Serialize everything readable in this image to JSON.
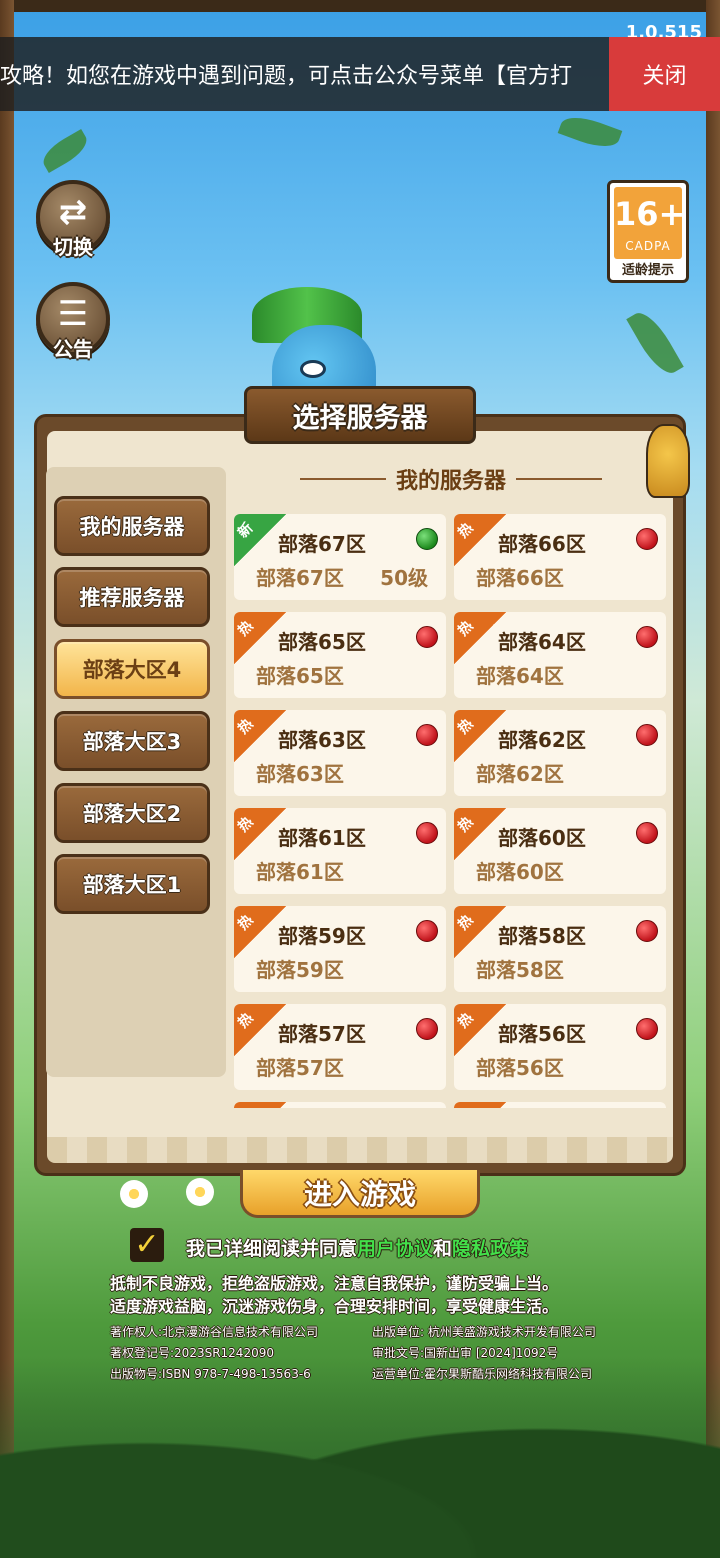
{
  "version": "1.0.515",
  "notice": {
    "text": "攻略！如您在游戏中遇到问题，可点击公众号菜单【官方打",
    "close_label": "关闭"
  },
  "side_buttons": {
    "switch": {
      "glyph": "⇄",
      "label": "切换"
    },
    "announce": {
      "glyph": "☰",
      "label": "公告"
    }
  },
  "age_rating": {
    "age": "16+",
    "org": "CADPA",
    "tip": "适龄提示"
  },
  "panel": {
    "title": "选择服务器",
    "section_title": "我的服务器"
  },
  "categories": [
    {
      "label": "我的服务器",
      "active": false
    },
    {
      "label": "推荐服务器",
      "active": false
    },
    {
      "label": "部落大区4",
      "active": true
    },
    {
      "label": "部落大区3",
      "active": false
    },
    {
      "label": "部落大区2",
      "active": false
    },
    {
      "label": "部落大区1",
      "active": false
    }
  ],
  "servers": [
    {
      "tag": "新",
      "name": "部落67区",
      "sub": "部落67区",
      "level": "50级",
      "status": "green"
    },
    {
      "tag": "热",
      "name": "部落66区",
      "sub": "部落66区",
      "level": "",
      "status": "red"
    },
    {
      "tag": "热",
      "name": "部落65区",
      "sub": "部落65区",
      "level": "",
      "status": "red"
    },
    {
      "tag": "热",
      "name": "部落64区",
      "sub": "部落64区",
      "level": "",
      "status": "red"
    },
    {
      "tag": "热",
      "name": "部落63区",
      "sub": "部落63区",
      "level": "",
      "status": "red"
    },
    {
      "tag": "热",
      "name": "部落62区",
      "sub": "部落62区",
      "level": "",
      "status": "red"
    },
    {
      "tag": "热",
      "name": "部落61区",
      "sub": "部落61区",
      "level": "",
      "status": "red"
    },
    {
      "tag": "热",
      "name": "部落60区",
      "sub": "部落60区",
      "level": "",
      "status": "red"
    },
    {
      "tag": "热",
      "name": "部落59区",
      "sub": "部落59区",
      "level": "",
      "status": "red"
    },
    {
      "tag": "热",
      "name": "部落58区",
      "sub": "部落58区",
      "level": "",
      "status": "red"
    },
    {
      "tag": "热",
      "name": "部落57区",
      "sub": "部落57区",
      "level": "",
      "status": "red"
    },
    {
      "tag": "热",
      "name": "部落56区",
      "sub": "部落56区",
      "level": "",
      "status": "red"
    }
  ],
  "enter_label": "进入游戏",
  "agreement": {
    "prefix": "我已详细阅读并同意",
    "user_agreement": "用户协议",
    "and": "和",
    "privacy": "隐私政策"
  },
  "health_notice": [
    "抵制不良游戏，拒绝盗版游戏，注意自我保护，谨防受骗上当。",
    "适度游戏益脑，沉迷游戏伤身，合理安排时间，享受健康生活。"
  ],
  "legal": {
    "copyright_owner": "著作权人:北京漫游谷信息技术有限公司",
    "reg_no": "著权登记号:2023SR1242090",
    "isbn": "出版物号:ISBN 978-7-498-13563-6",
    "publisher": "出版单位: 杭州美盛游戏技术开发有限公司",
    "approval": "审批文号:国新出审 [2024]1092号",
    "operator": "运营单位:霍尔果斯酷乐网络科技有限公司"
  }
}
